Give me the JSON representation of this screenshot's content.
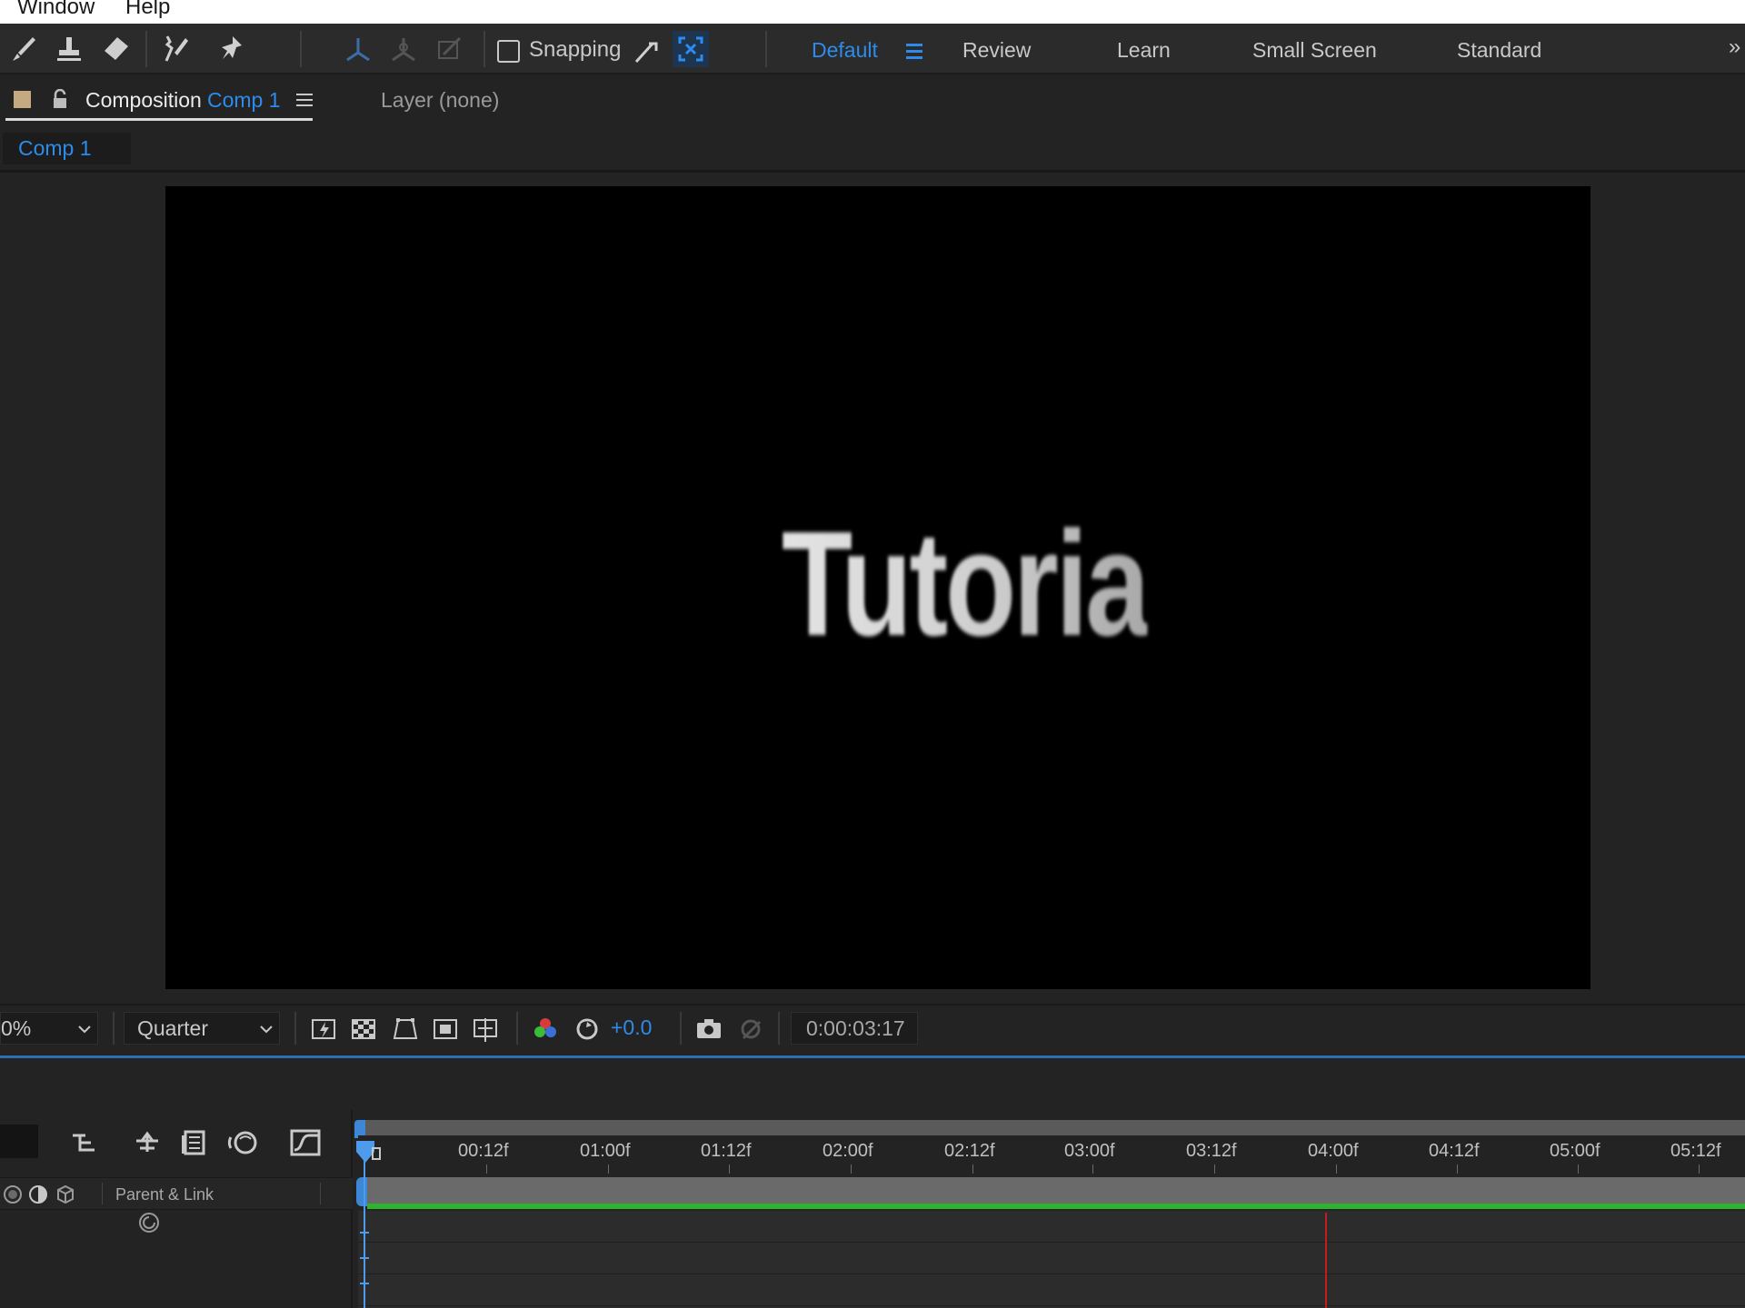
{
  "menubar": {
    "items": [
      "Window",
      "Help"
    ]
  },
  "toolbar": {
    "tools": [
      "brush-icon",
      "clone-stamp-icon",
      "eraser-icon",
      "roto-brush-icon",
      "puppet-pin-icon",
      "axis-local-icon",
      "axis-world-icon",
      "axis-view-icon"
    ],
    "snapping_label": "Snapping"
  },
  "workspaces": {
    "items": [
      "Default",
      "Review",
      "Learn",
      "Small Screen",
      "Standard"
    ],
    "active": "Default"
  },
  "panel": {
    "tab_label": "Composition",
    "tab_comp_name": "Comp 1",
    "layer_tab": "Layer  (none)",
    "breadcrumb": "Comp 1"
  },
  "canvas": {
    "text": "Tutoria"
  },
  "viewer_footer": {
    "zoom": "0%",
    "resolution": "Quarter",
    "exposure": "+0.0",
    "timecode": "0:00:03:17"
  },
  "timeline": {
    "ruler_ticks": [
      "00:12f",
      "01:00f",
      "01:12f",
      "02:00f",
      "02:12f",
      "03:00f",
      "03:12f",
      "04:00f",
      "04:12f",
      "05:00f",
      "05:12f"
    ],
    "parent_link_label": "Parent & Link"
  },
  "colors": {
    "accent": "#2d8ceb",
    "work_area_green": "#2db32d",
    "marker_red": "#c41b1b"
  }
}
